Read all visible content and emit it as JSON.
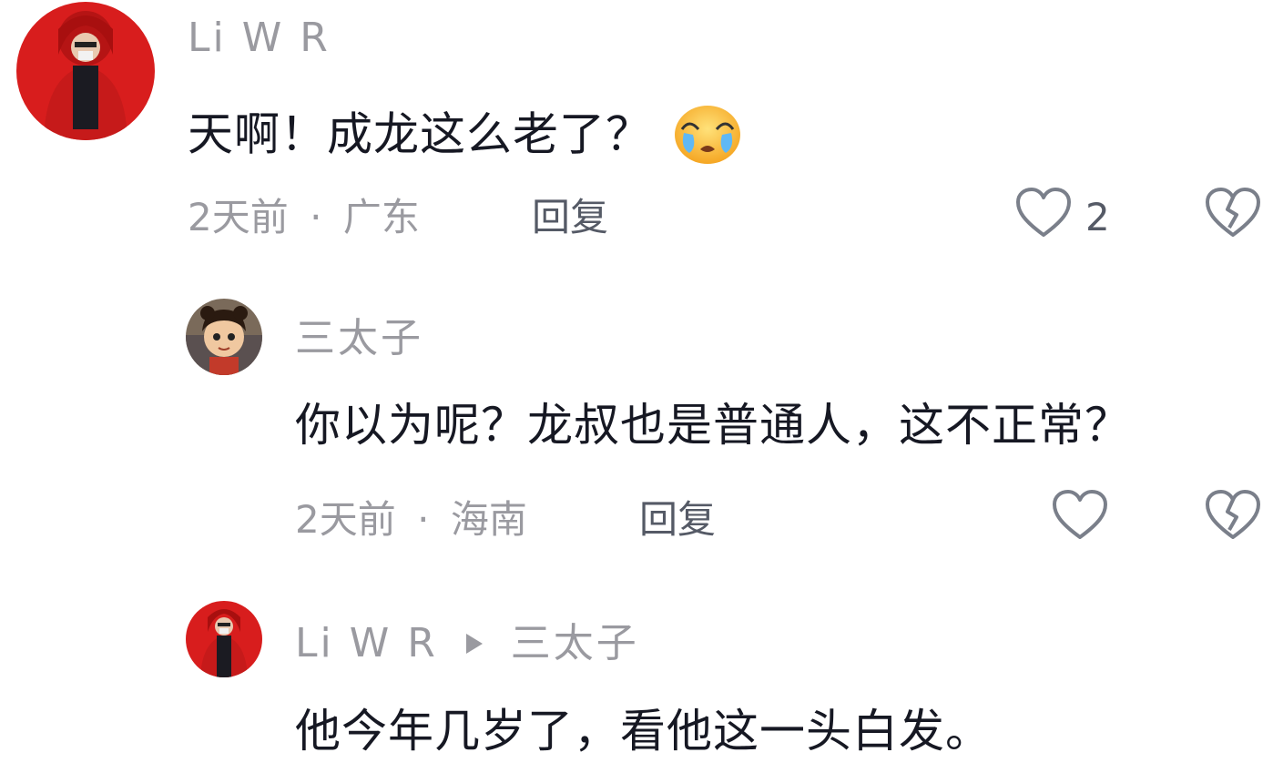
{
  "comments": [
    {
      "username": "Li W R",
      "text": "天啊！成龙这么老了？",
      "emoji": "crying-face-emoji",
      "time": "2天前",
      "separator": "·",
      "location": "广东",
      "reply_label": "回复",
      "like_count": "2",
      "avatar": "red-hoodie-avatar"
    },
    {
      "username": "三太子",
      "text": "你以为呢？龙叔也是普通人，这不正常？",
      "time": "2天前",
      "separator": "·",
      "location": "海南",
      "reply_label": "回复",
      "avatar": "cartoon-boy-avatar"
    },
    {
      "username": "Li W R",
      "reply_to": "三太子",
      "text": "他今年几岁了，看他这一头白发。",
      "avatar": "red-hoodie-avatar"
    }
  ],
  "icons": {
    "like": "heart-outline-icon",
    "dislike": "broken-heart-icon",
    "reply_arrow": "play-arrow-icon"
  },
  "colors": {
    "primary_text": "#161823",
    "secondary_text": "#9a9aa0",
    "reply_text": "#555a66",
    "background": "#ffffff"
  }
}
